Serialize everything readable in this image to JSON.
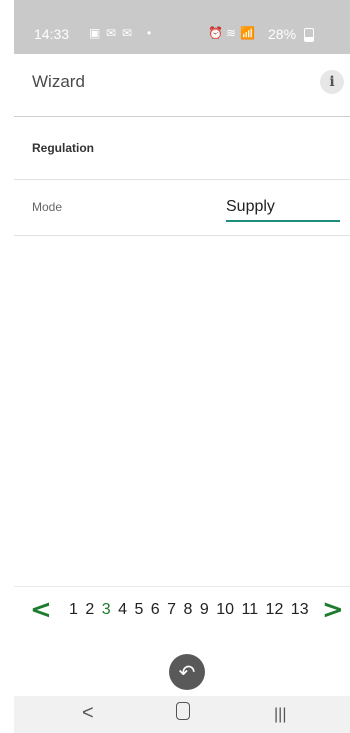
{
  "status_bar": {
    "time": "14:33",
    "battery": "28%"
  },
  "app": {
    "title": "Wizard",
    "info_icon_label": "i"
  },
  "section": {
    "title": "Regulation"
  },
  "form": {
    "mode_label": "Mode",
    "mode_value": "Supply"
  },
  "pager": {
    "prev": "<",
    "next": ">",
    "pages": [
      "1",
      "2",
      "3",
      "4",
      "5",
      "6",
      "7",
      "8",
      "9",
      "10",
      "11",
      "12",
      "13"
    ],
    "active_page": "3",
    "accent_color": "#1f7b2f"
  },
  "navigation": {
    "back_icon": "undo-arrow-icon"
  },
  "system_nav": {
    "back": "<",
    "recent": "|||"
  }
}
